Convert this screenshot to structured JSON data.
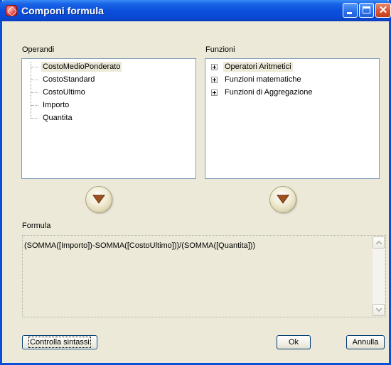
{
  "window": {
    "title": "Componi formula"
  },
  "operands": {
    "label": "Operandi",
    "items": [
      "CostoMedioPonderato",
      "CostoStandard",
      "CostoUltimo",
      "Importo",
      "Quantita"
    ],
    "selected_index": 0
  },
  "functions": {
    "label": "Funzioni",
    "items": [
      "Operatori Aritmetici",
      "Funzioni matematiche",
      "Funzioni di Aggregazione"
    ],
    "selected_index": 0
  },
  "formula": {
    "label": "Formula",
    "value": "(SOMMA([Importo])-SOMMA([CostoUltimo]))/(SOMMA([Quantita]))"
  },
  "buttons": {
    "check_syntax": "Controlla sintassi",
    "ok": "Ok",
    "cancel": "Annulla"
  },
  "icons": {
    "insert_operand": "arrow-down-icon",
    "insert_function": "arrow-down-icon"
  },
  "colors": {
    "titlebar": "#0b4fdc",
    "dialog_bg": "#ece9d8",
    "arrow_fill": "#a0521e"
  }
}
